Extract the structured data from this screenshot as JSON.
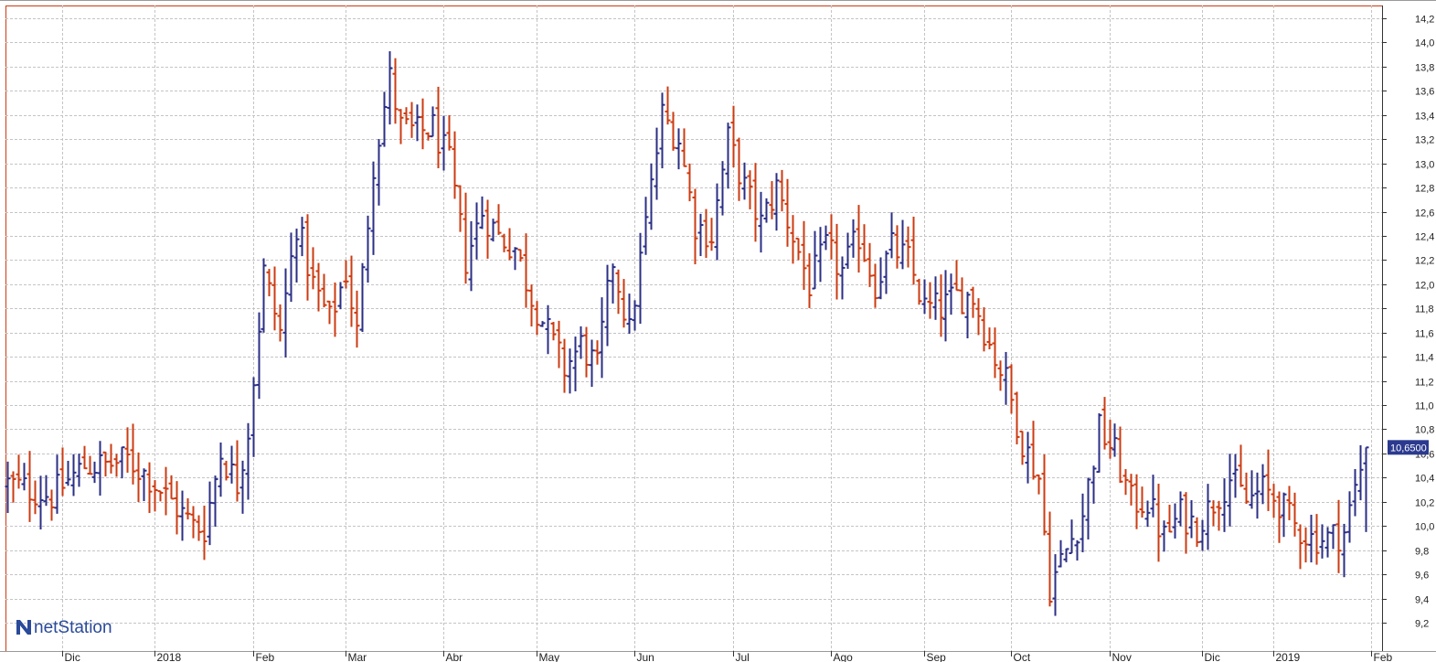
{
  "chart_data": {
    "type": "ohlc",
    "title": "",
    "xlabel": "",
    "ylabel": "",
    "ylim": [
      9.0,
      14.3
    ],
    "y_ticks": [
      "14,2",
      "14,0",
      "13,8",
      "13,6",
      "13,4",
      "13,2",
      "13,0",
      "12,8",
      "12,6",
      "12,4",
      "12,2",
      "12,0",
      "11,8",
      "11,6",
      "11,4",
      "11,2",
      "11,0",
      "10,8",
      "10,6",
      "10,4",
      "10,2",
      "10,0",
      "9,8",
      "9,6",
      "9,4",
      "9,2"
    ],
    "x_labels": [
      "Dic",
      "2018",
      "Feb",
      "Mar",
      "Abr",
      "May",
      "Jun",
      "Jul",
      "Ago",
      "Sep",
      "Oct",
      "Nov",
      "Dic",
      "2019",
      "Feb"
    ],
    "grid": true,
    "up_color": "#2b2f85",
    "down_color": "#cc3b12",
    "last_value": 10.65,
    "last_value_label": "10,6500",
    "close_anchors": [
      [
        0,
        10.35
      ],
      [
        8,
        10.25
      ],
      [
        14,
        10.5
      ],
      [
        18,
        10.5
      ],
      [
        22,
        10.55
      ],
      [
        26,
        10.4
      ],
      [
        30,
        10.2
      ],
      [
        34,
        10.0
      ],
      [
        36,
        9.98
      ],
      [
        39,
        10.6
      ],
      [
        42,
        10.35
      ],
      [
        44,
        10.8
      ],
      [
        47,
        12.1
      ],
      [
        50,
        11.6
      ],
      [
        53,
        12.5
      ],
      [
        56,
        12.0
      ],
      [
        59,
        11.7
      ],
      [
        62,
        12.1
      ],
      [
        64,
        11.6
      ],
      [
        67,
        13.0
      ],
      [
        70,
        13.7
      ],
      [
        72,
        13.3
      ],
      [
        75,
        13.25
      ],
      [
        78,
        13.3
      ],
      [
        81,
        13.0
      ],
      [
        84,
        12.2
      ],
      [
        87,
        12.6
      ],
      [
        90,
        12.4
      ],
      [
        93,
        12.3
      ],
      [
        96,
        11.9
      ],
      [
        99,
        11.6
      ],
      [
        102,
        11.3
      ],
      [
        105,
        11.5
      ],
      [
        108,
        11.3
      ],
      [
        111,
        12.2
      ],
      [
        114,
        11.6
      ],
      [
        117,
        12.5
      ],
      [
        120,
        13.4
      ],
      [
        123,
        13.2
      ],
      [
        126,
        12.5
      ],
      [
        129,
        12.4
      ],
      [
        132,
        13.2
      ],
      [
        135,
        12.8
      ],
      [
        138,
        12.5
      ],
      [
        141,
        12.8
      ],
      [
        144,
        12.4
      ],
      [
        147,
        12.0
      ],
      [
        150,
        12.3
      ],
      [
        153,
        12.1
      ],
      [
        156,
        12.4
      ],
      [
        159,
        12.0
      ],
      [
        162,
        12.3
      ],
      [
        165,
        12.2
      ],
      [
        168,
        11.8
      ],
      [
        171,
        11.8
      ],
      [
        174,
        11.9
      ],
      [
        177,
        11.9
      ],
      [
        180,
        11.5
      ],
      [
        183,
        11.2
      ],
      [
        186,
        10.7
      ],
      [
        189,
        10.4
      ],
      [
        191,
        9.5
      ],
      [
        194,
        9.8
      ],
      [
        197,
        10.1
      ],
      [
        200,
        10.8
      ],
      [
        203,
        10.6
      ],
      [
        206,
        10.2
      ],
      [
        209,
        10.2
      ],
      [
        212,
        9.9
      ],
      [
        215,
        10.1
      ],
      [
        218,
        10.0
      ],
      [
        221,
        10.2
      ],
      [
        224,
        10.4
      ],
      [
        227,
        10.2
      ],
      [
        230,
        10.3
      ],
      [
        233,
        10.2
      ],
      [
        236,
        10.0
      ],
      [
        239,
        9.9
      ],
      [
        242,
        9.9
      ],
      [
        245,
        9.95
      ],
      [
        249,
        10.65
      ]
    ],
    "month_index": [
      10,
      27,
      45,
      62,
      80,
      97,
      115,
      133,
      151,
      168,
      184,
      202,
      219,
      232,
      250
    ]
  },
  "branding": {
    "logo_text": "netStation",
    "logo_icon": "netstation-logo-icon"
  }
}
